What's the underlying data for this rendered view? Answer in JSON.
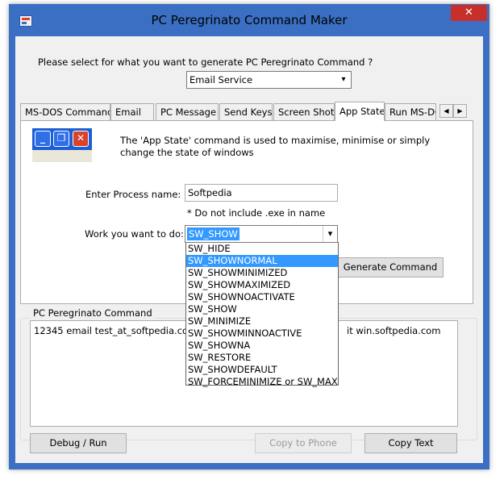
{
  "window": {
    "title": "PC Peregrinato Command Maker",
    "close_glyph": "✕"
  },
  "service": {
    "prompt": "Please select for what you want to generate PC Peregrinato Command ?",
    "selected": "Email Service"
  },
  "tabs": [
    "MS-DOS Command",
    "Email",
    "PC Message",
    "Send Keys",
    "Screen Shot",
    "App State",
    "Run MS-DOS"
  ],
  "active_tab": "App State",
  "app_state": {
    "description_line1": "The 'App State' command is used to maximise, minimise or simply",
    "description_line2": "change the state of windows",
    "process_label": "Enter Process name:",
    "process_value": "Softpedia",
    "process_hint": "* Do not include .exe in name",
    "work_label": "Work you want to do:",
    "work_selected": "SW_SHOW",
    "options": [
      "SW_HIDE",
      "SW_SHOWNORMAL",
      "SW_SHOWMINIMIZED",
      "SW_SHOWMAXIMIZED",
      "SW_SHOWNOACTIVATE",
      "SW_SHOW",
      "SW_MINIMIZE",
      "SW_SHOWMINNOACTIVE",
      "SW_SHOWNA",
      "SW_RESTORE",
      "SW_SHOWDEFAULT",
      "SW_FORCEMINIMIZE or SW_MAX"
    ],
    "highlighted_option": "SW_SHOWNORMAL",
    "generate_label": "Generate Command"
  },
  "output": {
    "group_label": "PC Peregrinato Command",
    "text_left": "12345 email test_at_softpedia.com",
    "text_right": "it win.softpedia.com"
  },
  "buttons": {
    "debug": "Debug / Run",
    "copy_phone": "Copy to Phone",
    "copy_text": "Copy Text"
  },
  "icons": {
    "minimize": "_",
    "restore": "❐",
    "close": "✕",
    "tab_left": "◀",
    "tab_right": "▶",
    "dropdown": "▾"
  }
}
